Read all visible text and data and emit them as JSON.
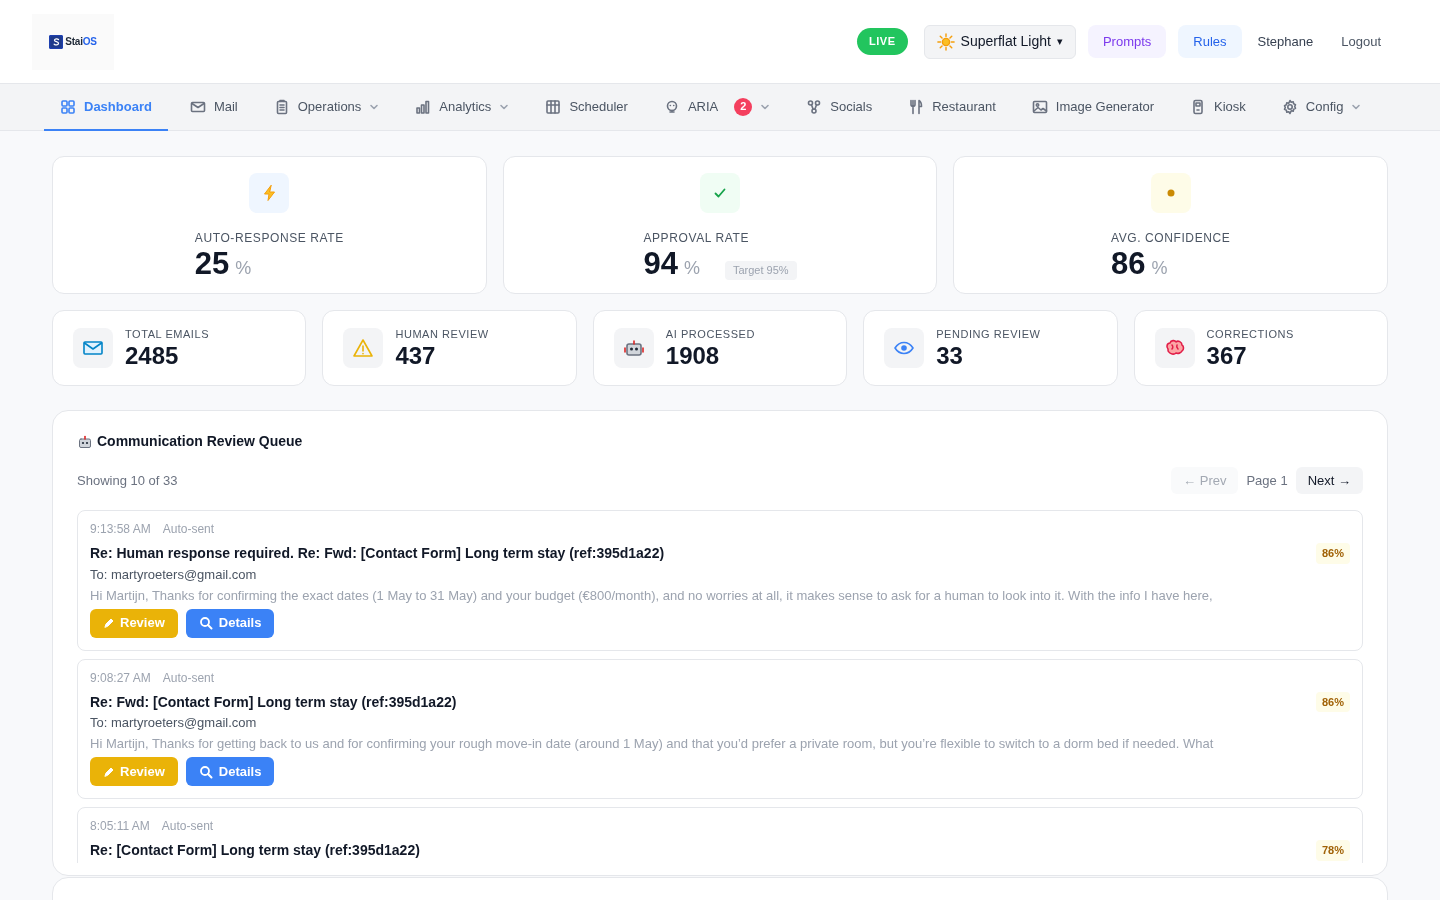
{
  "header": {
    "status_badge": "LIVE",
    "theme_selector": {
      "label": "Superflat Light",
      "caret": "▾"
    },
    "buttons": [
      {
        "label": "Prompts",
        "kind": "prompts"
      },
      {
        "label": "Rules",
        "kind": "rules"
      }
    ],
    "user": "Stephane",
    "logout": "Logout",
    "logo": {
      "text": "Stai",
      "accent": "OS"
    }
  },
  "nav": [
    {
      "label": "Dashboard",
      "selected": true,
      "dropdown": false
    },
    {
      "label": "Mail",
      "selected": false,
      "dropdown": false
    },
    {
      "label": "Operations",
      "selected": false,
      "dropdown": true
    },
    {
      "label": "Analytics",
      "selected": false,
      "dropdown": true
    },
    {
      "label": "Scheduler",
      "selected": false,
      "dropdown": false
    },
    {
      "label": "ARIA",
      "selected": false,
      "dropdown": true,
      "badge": "2"
    },
    {
      "label": "Socials",
      "selected": false,
      "dropdown": false
    },
    {
      "label": "Restaurant",
      "selected": false,
      "dropdown": false
    },
    {
      "label": "Image Generator",
      "selected": false,
      "dropdown": false
    },
    {
      "label": "Kiosk",
      "selected": false,
      "dropdown": false
    },
    {
      "label": "Config",
      "selected": false,
      "dropdown": true
    }
  ],
  "rate_cards": [
    {
      "kind": "bolt",
      "label": "AUTO-RESPONSE RATE",
      "value": "25",
      "unit": "%"
    },
    {
      "kind": "check",
      "label": "APPROVAL RATE",
      "value": "94",
      "unit": "%",
      "target": "Target 95%"
    },
    {
      "kind": "dot",
      "label": "AVG. CONFIDENCE",
      "value": "86",
      "unit": "%"
    }
  ],
  "stat_cards": [
    {
      "kind": "mail",
      "label": "TOTAL EMAILS",
      "value": "2485"
    },
    {
      "kind": "warning",
      "label": "HUMAN REVIEW",
      "value": "437"
    },
    {
      "kind": "robot",
      "label": "AI PROCESSED",
      "value": "1908"
    },
    {
      "kind": "eye",
      "label": "PENDING REVIEW",
      "value": "33"
    },
    {
      "kind": "brain",
      "label": "CORRECTIONS",
      "value": "367"
    }
  ],
  "queue": {
    "title": "Communication Review Queue",
    "showing": "Showing 10 of 33",
    "pagination": {
      "prev": "← Prev",
      "page": "Page 1",
      "next": "Next →",
      "prev_disabled": true
    },
    "items": [
      {
        "time": "9:13:58 AM",
        "status": "Auto-sent",
        "subject": "Re: Human response required. Re: Fwd: [Contact Form] Long term stay (ref:395d1a22)",
        "confidence": "86%",
        "to": "To: martyroeters@gmail.com",
        "preview": "Hi Martijn, Thanks for confirming the exact dates (1 May to 31 May) and your budget (€800/month), and no worries at all, it makes sense to ask for a human to look into it. With the info I have here,",
        "review": "Review",
        "details": "Details"
      },
      {
        "time": "9:08:27 AM",
        "status": "Auto-sent",
        "subject": "Re: Fwd: [Contact Form] Long term stay (ref:395d1a22)",
        "confidence": "86%",
        "to": "To: martyroeters@gmail.com",
        "preview": "Hi Martijn, Thanks for getting back to us and for confirming your rough move-in date (around 1 May) and that you’d prefer a private room, but you’re flexible to switch to a dorm bed if needed. What",
        "review": "Review",
        "details": "Details"
      },
      {
        "time": "8:05:11 AM",
        "status": "Auto-sent",
        "subject": "Re: [Contact Form] Long term stay (ref:395d1a22)",
        "confidence": "78%"
      }
    ]
  }
}
